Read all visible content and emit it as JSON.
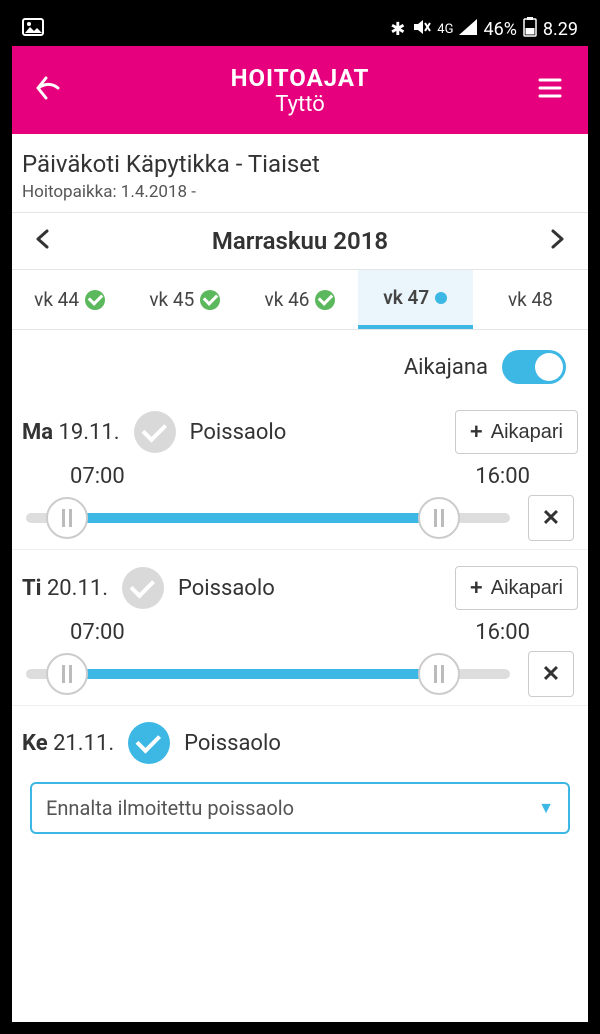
{
  "status_bar": {
    "battery_pct": "46%",
    "time": "8.29",
    "network": "4G"
  },
  "header": {
    "title": "HOITOAJAT",
    "subtitle": "Tyttö"
  },
  "location": {
    "name": "Päiväkoti Käpytikka - Tiaiset",
    "care_place": "Hoitopaikka: 1.4.2018 -"
  },
  "month_nav": {
    "label": "Marraskuu 2018"
  },
  "weeks": [
    {
      "label": "vk 44",
      "status": "check"
    },
    {
      "label": "vk 45",
      "status": "check"
    },
    {
      "label": "vk 46",
      "status": "check"
    },
    {
      "label": "vk 47",
      "status": "dot",
      "active": true
    },
    {
      "label": "vk 48",
      "status": ""
    }
  ],
  "timeline": {
    "label": "Aikajana",
    "enabled": true
  },
  "common": {
    "absence_label": "Poissaolo",
    "aikapari_label": "Aikapari"
  },
  "days": [
    {
      "short": "Ma",
      "date": "19.11.",
      "absent": false,
      "start": "07:00",
      "end": "16:00"
    },
    {
      "short": "Ti",
      "date": "20.11.",
      "absent": false,
      "start": "07:00",
      "end": "16:00"
    },
    {
      "short": "Ke",
      "date": "21.11.",
      "absent": true,
      "absence_reason": "Ennalta ilmoitettu poissaolo"
    }
  ]
}
